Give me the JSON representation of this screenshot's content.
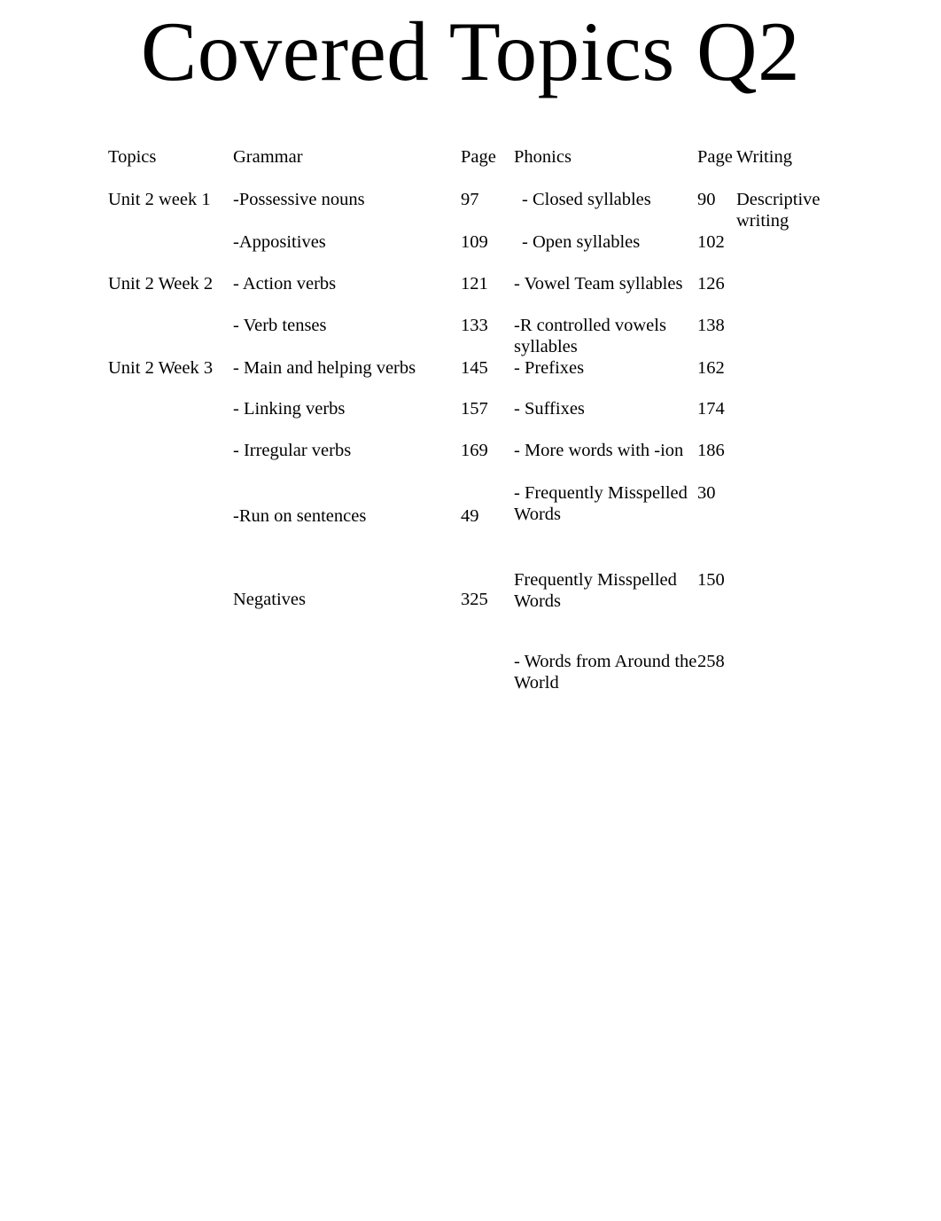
{
  "document": {
    "title": "Covered Topics Q2",
    "background_color": "#ffffff",
    "text_color": "#000000"
  },
  "table": {
    "headers": {
      "topics": "Topics",
      "grammar": "Grammar",
      "grammar_page": "Page",
      "phonics": "Phonics",
      "phonics_page": "Page",
      "writing": "Writing"
    },
    "rows": [
      {
        "topic": "Unit 2 week  1",
        "grammar": "-Possessive nouns",
        "grammar_page": "97",
        "phonics": "- Closed syllables",
        "phonics_page": "90",
        "writing": "Descriptive writing"
      },
      {
        "topic": "",
        "grammar": "-Appositives",
        "grammar_page": "109",
        "phonics": "- Open syllables",
        "phonics_page": "102",
        "writing": ""
      },
      {
        "topic": "Unit 2 Week 2",
        "grammar": "- Action verbs",
        "grammar_page": "121",
        "phonics": "- Vowel Team syllables",
        "phonics_page": "126",
        "writing": ""
      },
      {
        "topic": "",
        "grammar": "- Verb tenses",
        "grammar_page": "133",
        "phonics": "-R controlled vowels syllables",
        "phonics_page": "138",
        "writing": ""
      },
      {
        "topic": "Unit 2 Week 3",
        "grammar": "- Main and helping verbs",
        "grammar_page": "145",
        "phonics": "- Prefixes",
        "phonics_page": "162",
        "writing": ""
      },
      {
        "topic": "",
        "grammar": "- Linking verbs",
        "grammar_page": "157",
        "phonics": "- Suffixes",
        "phonics_page": "174",
        "writing": ""
      },
      {
        "topic": "",
        "grammar": "- Irregular verbs",
        "grammar_page": "169",
        "phonics": "- More words with -ion",
        "phonics_page": "186",
        "writing": ""
      },
      {
        "topic": "",
        "grammar": "-Run on sentences",
        "grammar_page": "49",
        "phonics": "- Frequently Misspelled Words",
        "phonics_page": "30",
        "writing": ""
      },
      {
        "topic": "",
        "grammar": "Negatives",
        "grammar_page": "325",
        "phonics": "Frequently Misspelled Words",
        "phonics_page": "150",
        "writing": ""
      },
      {
        "topic": "",
        "grammar": "",
        "grammar_page": "",
        "phonics": "- Words from Around the World",
        "phonics_page": "258",
        "writing": ""
      }
    ]
  }
}
